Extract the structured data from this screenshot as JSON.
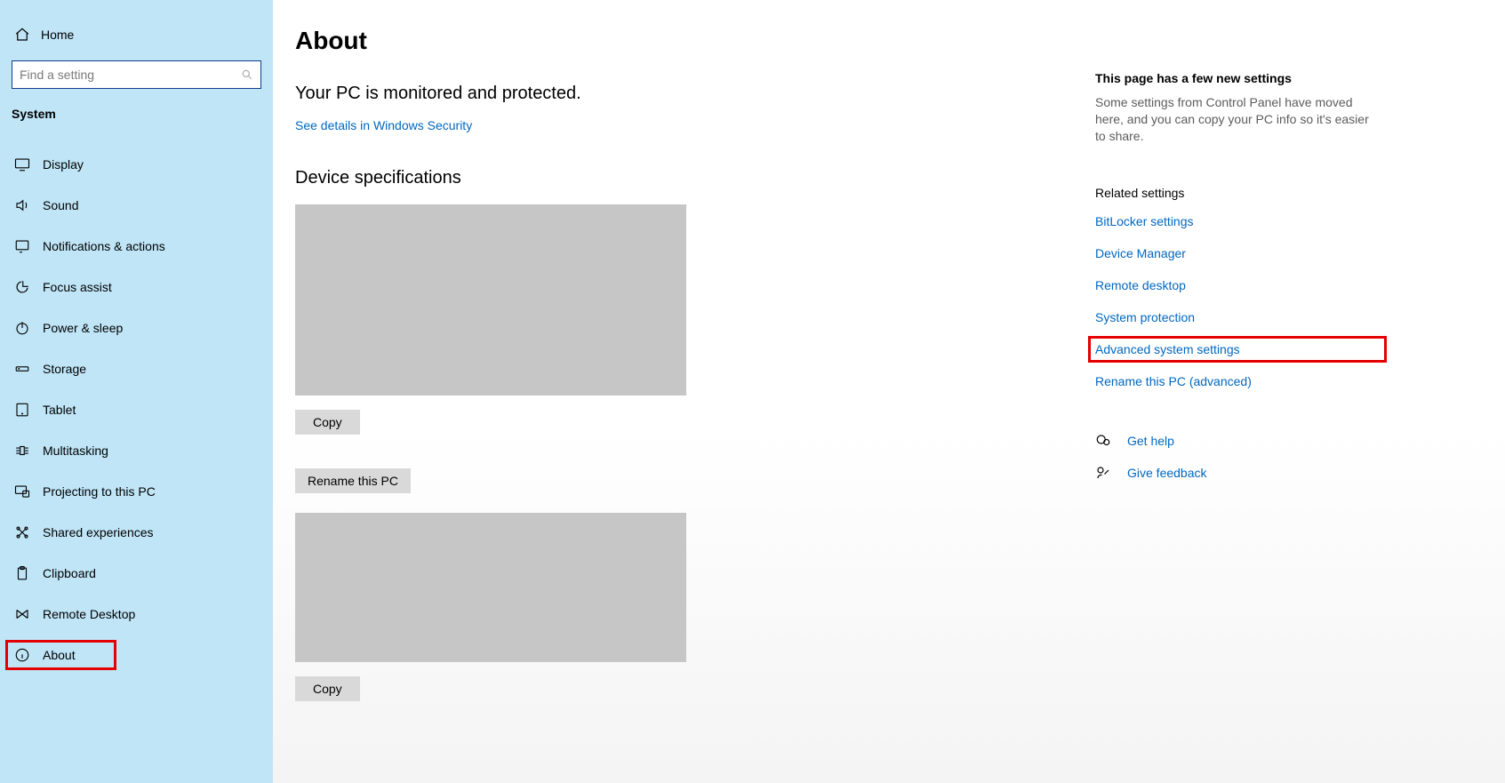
{
  "sidebar": {
    "home": "Home",
    "searchPlaceholder": "Find a setting",
    "sectionLabel": "System",
    "items": [
      {
        "label": "Display",
        "icon": "display-icon"
      },
      {
        "label": "Sound",
        "icon": "sound-icon"
      },
      {
        "label": "Notifications & actions",
        "icon": "notifications-icon"
      },
      {
        "label": "Focus assist",
        "icon": "focus-assist-icon"
      },
      {
        "label": "Power & sleep",
        "icon": "power-icon"
      },
      {
        "label": "Storage",
        "icon": "storage-icon"
      },
      {
        "label": "Tablet",
        "icon": "tablet-icon"
      },
      {
        "label": "Multitasking",
        "icon": "multitasking-icon"
      },
      {
        "label": "Projecting to this PC",
        "icon": "projecting-icon"
      },
      {
        "label": "Shared experiences",
        "icon": "shared-icon"
      },
      {
        "label": "Clipboard",
        "icon": "clipboard-icon"
      },
      {
        "label": "Remote Desktop",
        "icon": "remote-desktop-icon"
      },
      {
        "label": "About",
        "icon": "about-icon"
      }
    ]
  },
  "main": {
    "pageTitle": "About",
    "statusLine": "Your PC is monitored and protected.",
    "securityLink": "See details in Windows Security",
    "specHeading": "Device specifications",
    "copyLabel": "Copy",
    "renameLabel": "Rename this PC",
    "copyLabel2": "Copy"
  },
  "right": {
    "newHeading": "This page has a few new settings",
    "newText": "Some settings from Control Panel have moved here, and you can copy your PC info so it's easier to share.",
    "relatedHeading": "Related settings",
    "links": [
      "BitLocker settings",
      "Device Manager",
      "Remote desktop",
      "System protection",
      "Advanced system settings",
      "Rename this PC (advanced)"
    ],
    "helpLabel": "Get help",
    "feedbackLabel": "Give feedback"
  }
}
